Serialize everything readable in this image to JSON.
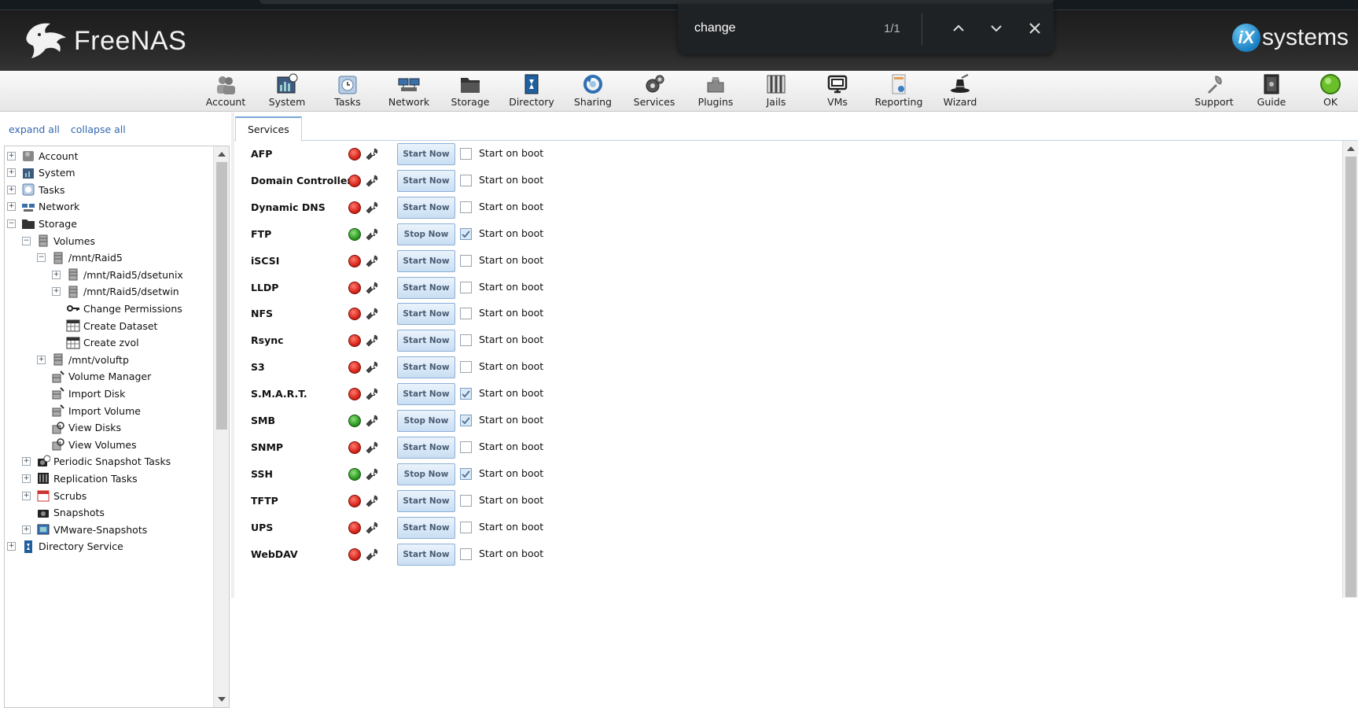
{
  "header": {
    "brand": "FreeNAS",
    "vendor_badge": "iX",
    "vendor_text": "systems"
  },
  "find": {
    "query": "change",
    "count": "1/1"
  },
  "toolbar": {
    "items": [
      {
        "label": "Account",
        "icon": "account-icon"
      },
      {
        "label": "System",
        "icon": "system-icon"
      },
      {
        "label": "Tasks",
        "icon": "tasks-icon"
      },
      {
        "label": "Network",
        "icon": "network-icon"
      },
      {
        "label": "Storage",
        "icon": "storage-icon"
      },
      {
        "label": "Directory",
        "icon": "directory-icon"
      },
      {
        "label": "Sharing",
        "icon": "sharing-icon"
      },
      {
        "label": "Services",
        "icon": "services-icon"
      },
      {
        "label": "Plugins",
        "icon": "plugins-icon"
      },
      {
        "label": "Jails",
        "icon": "jails-icon"
      },
      {
        "label": "VMs",
        "icon": "vms-icon"
      },
      {
        "label": "Reporting",
        "icon": "reporting-icon"
      },
      {
        "label": "Wizard",
        "icon": "wizard-icon"
      }
    ],
    "right_items": [
      {
        "label": "Support",
        "icon": "support-icon"
      },
      {
        "label": "Guide",
        "icon": "guide-icon"
      },
      {
        "label": "OK",
        "icon": "status-ok-icon"
      }
    ]
  },
  "sidebar": {
    "expand_all": "expand all",
    "collapse_all": "collapse all",
    "tree": [
      {
        "label": "Account",
        "level": 0,
        "expander": "+"
      },
      {
        "label": "System",
        "level": 0,
        "expander": "+"
      },
      {
        "label": "Tasks",
        "level": 0,
        "expander": "+"
      },
      {
        "label": "Network",
        "level": 0,
        "expander": "+"
      },
      {
        "label": "Storage",
        "level": 0,
        "expander": "−"
      },
      {
        "label": "Volumes",
        "level": 1,
        "expander": "−"
      },
      {
        "label": "/mnt/Raid5",
        "level": 2,
        "expander": "−"
      },
      {
        "label": "/mnt/Raid5/dsetunix",
        "level": 3,
        "expander": "+"
      },
      {
        "label": "/mnt/Raid5/dsetwin",
        "level": 3,
        "expander": "+"
      },
      {
        "label": "Change Permissions",
        "level": 3,
        "expander": ""
      },
      {
        "label": "Create Dataset",
        "level": 3,
        "expander": ""
      },
      {
        "label": "Create zvol",
        "level": 3,
        "expander": ""
      },
      {
        "label": "/mnt/voluftp",
        "level": 2,
        "expander": "+"
      },
      {
        "label": "Volume Manager",
        "level": 2,
        "expander": ""
      },
      {
        "label": "Import Disk",
        "level": 2,
        "expander": ""
      },
      {
        "label": "Import Volume",
        "level": 2,
        "expander": ""
      },
      {
        "label": "View Disks",
        "level": 2,
        "expander": ""
      },
      {
        "label": "View Volumes",
        "level": 2,
        "expander": ""
      },
      {
        "label": "Periodic Snapshot Tasks",
        "level": 1,
        "expander": "+"
      },
      {
        "label": "Replication Tasks",
        "level": 1,
        "expander": "+"
      },
      {
        "label": "Scrubs",
        "level": 1,
        "expander": "+"
      },
      {
        "label": "Snapshots",
        "level": 1,
        "expander": ""
      },
      {
        "label": "VMware-Snapshots",
        "level": 1,
        "expander": "+"
      },
      {
        "label": "Directory Service",
        "level": 0,
        "expander": "+"
      }
    ]
  },
  "main": {
    "tab": "Services",
    "boot_label": "Start on boot",
    "services": [
      {
        "name": "AFP",
        "running": false,
        "action": "Start Now",
        "boot": false
      },
      {
        "name": "Domain Controller",
        "running": false,
        "action": "Start Now",
        "boot": false
      },
      {
        "name": "Dynamic DNS",
        "running": false,
        "action": "Start Now",
        "boot": false
      },
      {
        "name": "FTP",
        "running": true,
        "action": "Stop Now",
        "boot": true
      },
      {
        "name": "iSCSI",
        "running": false,
        "action": "Start Now",
        "boot": false
      },
      {
        "name": "LLDP",
        "running": false,
        "action": "Start Now",
        "boot": false
      },
      {
        "name": "NFS",
        "running": false,
        "action": "Start Now",
        "boot": false
      },
      {
        "name": "Rsync",
        "running": false,
        "action": "Start Now",
        "boot": false
      },
      {
        "name": "S3",
        "running": false,
        "action": "Start Now",
        "boot": false
      },
      {
        "name": "S.M.A.R.T.",
        "running": false,
        "action": "Start Now",
        "boot": true
      },
      {
        "name": "SMB",
        "running": true,
        "action": "Stop Now",
        "boot": true
      },
      {
        "name": "SNMP",
        "running": false,
        "action": "Start Now",
        "boot": false
      },
      {
        "name": "SSH",
        "running": true,
        "action": "Stop Now",
        "boot": true
      },
      {
        "name": "TFTP",
        "running": false,
        "action": "Start Now",
        "boot": false
      },
      {
        "name": "UPS",
        "running": false,
        "action": "Start Now",
        "boot": false
      },
      {
        "name": "WebDAV",
        "running": false,
        "action": "Start Now",
        "boot": false
      }
    ]
  }
}
